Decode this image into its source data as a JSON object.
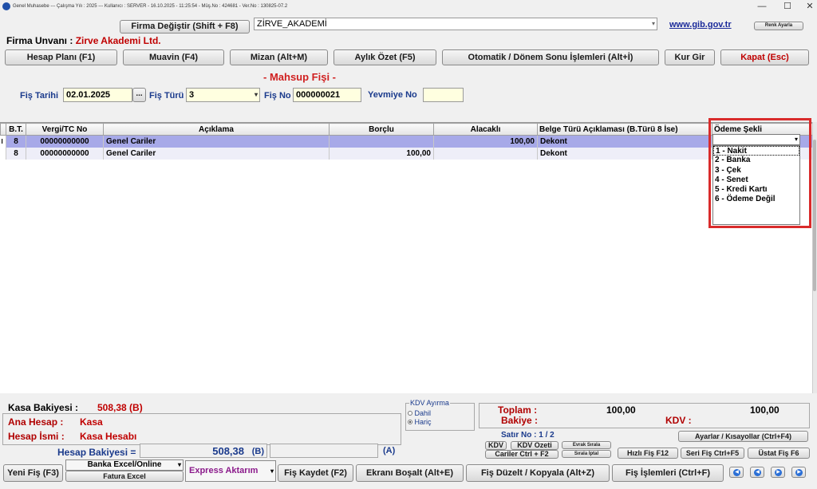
{
  "title_bar": {
    "text": "Genel Muhasebe  ---  Çalışma Yılı : 2025   ---  Kullanıcı : SERVER - 16.10.2025 - 11:25:54 - Müş.No : 424681 - Ver.No : 130825-07.2",
    "minimize": "—",
    "maximize": "☐",
    "close": "✕"
  },
  "header": {
    "firma_degistir": "Firma Değiştir (Shift + F8)",
    "firma_combo_value": "ZİRVE_AKADEMİ",
    "gib_link": "www.gib.gov.tr",
    "renk_ayarla": "Renk Ayarla",
    "firma_unvani_label": "Firma Unvanı :",
    "firma_unvani_value": "Zirve Akademi Ltd."
  },
  "toolbar": {
    "hesap_plani": "Hesap Planı (F1)",
    "muavin": "Muavin (F4)",
    "mizan": "Mizan (Alt+M)",
    "aylik_ozet": "Aylık Özet (F5)",
    "otomatik": "Otomatik / Dönem Sonu İşlemleri (Alt+İ)",
    "kur_gir": "Kur Gir",
    "kapat": "Kapat (Esc)"
  },
  "form": {
    "fis_title": "- Mahsup Fişi -",
    "fis_tarihi_label": "Fiş Tarihi",
    "fis_tarihi_value": "02.01.2025",
    "date_btn": "...",
    "fis_turu_label": "Fiş Türü",
    "fis_turu_value": "3",
    "fis_no_label": "Fiş No",
    "fis_no_value": "000000021",
    "yevmiye_label": "Yevmiye No",
    "yevmiye_value": ""
  },
  "grid": {
    "columns": [
      "",
      "B.T.",
      "Vergi/TC No",
      "Açıklama",
      "Borçlu",
      "Alacaklı",
      "Belge Türü Açıklaması (B.Türü 8 İse)",
      "Ödeme Şekli"
    ],
    "rows": [
      {
        "indicator": "I",
        "bt": "8",
        "vergi": "00000000000",
        "aciklama": "Genel Cariler",
        "borclu": "",
        "alacakli": "100,00",
        "belge": "Dekont",
        "odeme": ""
      },
      {
        "indicator": "",
        "bt": "8",
        "vergi": "00000000000",
        "aciklama": "Genel Cariler",
        "borclu": "100,00",
        "alacakli": "",
        "belge": "Dekont",
        "odeme": ""
      }
    ],
    "odeme_options": [
      "1 - Nakit",
      "2 - Banka",
      "3 - Çek",
      "4 - Senet",
      "5 - Kredi Kartı",
      "6 - Ödeme Değil"
    ]
  },
  "bottom": {
    "kasa_bakiyesi_label": "Kasa Bakiyesi :",
    "kasa_bakiyesi_value": "508,38  (B)",
    "ana_hesap_label": "Ana Hesap :",
    "ana_hesap_value": "Kasa",
    "hesap_ismi_label": "Hesap İsmi :",
    "hesap_ismi_value": "Kasa Hesabı",
    "hesap_bakiyesi_label": "Hesap Bakiyesi =",
    "hesap_bakiyesi_value": "508,38",
    "hesap_bakiyesi_b": "(B)",
    "a_label": "(A)",
    "kdv_ayirma_title": "KDV Ayırma",
    "kdv_dahil": "Dahil",
    "kdv_haric": "Hariç",
    "toplam_label": "Toplam :",
    "toplam_borc": "100,00",
    "toplam_alacak": "100,00",
    "bakiye_label": "Bakiye :",
    "kdv_label": "KDV :",
    "satir_no": "Satır No :  1 / 2",
    "ayarlar": "Ayarlar / Kısayollar (Ctrl+F4)",
    "kdv_btn": "KDV",
    "kdv_ozeti": "KDV Özeti",
    "evrak_sirala": "Evrak Sırala",
    "cariler": "Cariler Ctrl + F2",
    "sirala_iptal": "Sırala İptal",
    "hizli_fis": "Hızlı Fiş F12",
    "seri_fis": "Seri Fiş Ctrl+F5",
    "ustat_fis": "Üstat Fiş F6"
  },
  "footer": {
    "yeni_fis": "Yeni Fiş (F3)",
    "banka_excel": "Banka Excel/Online",
    "fatura_excel": "Fatura Excel",
    "express": "Express Aktarım",
    "fis_kaydet": "Fiş Kaydet (F2)",
    "ekrani_bosalt": "Ekranı Boşalt (Alt+E)",
    "fis_duzelt": "Fiş Düzelt / Kopyala (Alt+Z)",
    "fis_islemleri": "Fiş İşlemleri (Ctrl+F)"
  },
  "colors": {
    "accent_red": "#c00000",
    "label_blue": "#1a3a8c",
    "selected_row": "#a7a9e8",
    "highlight_box": "#d92b2b"
  }
}
